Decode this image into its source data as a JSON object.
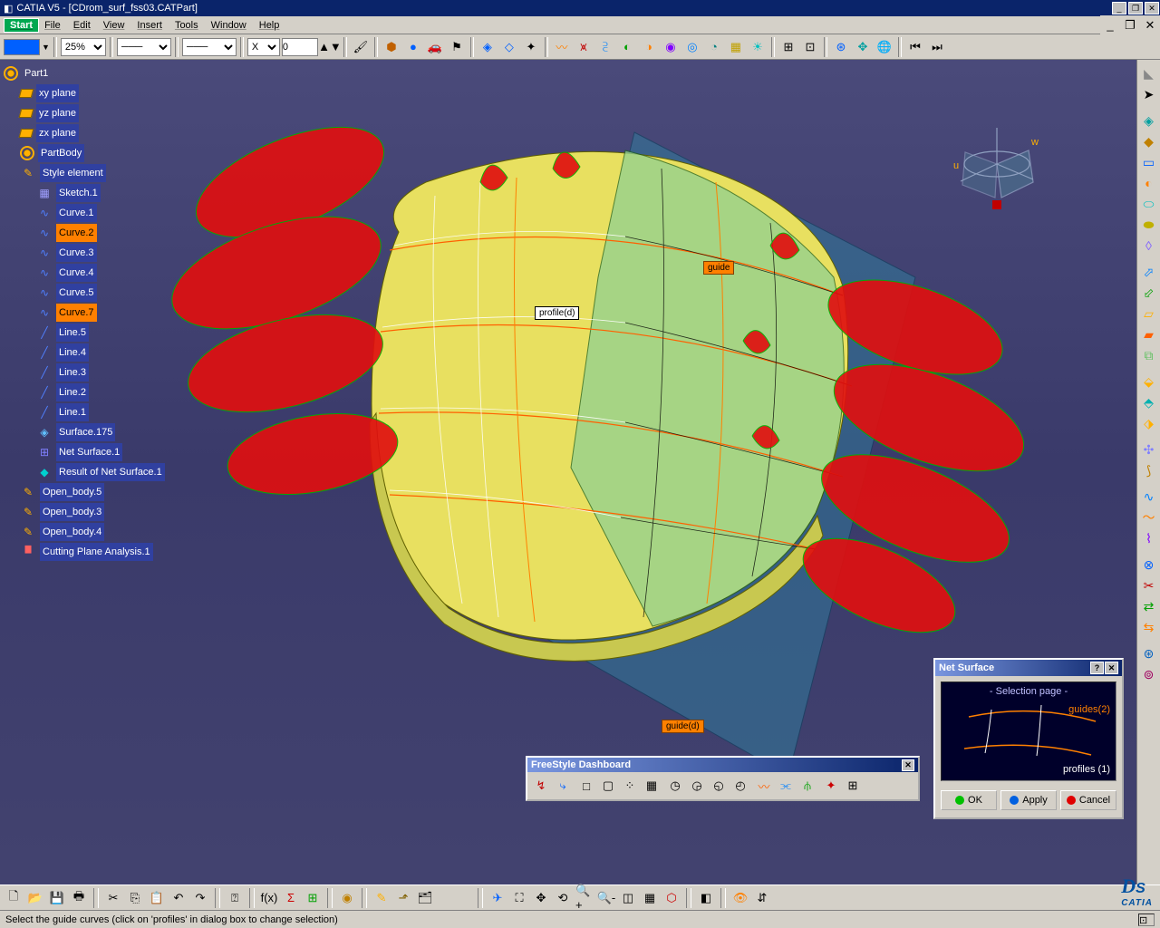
{
  "title": "CATIA V5 - [CDrom_surf_fss03.CATPart]",
  "menu": {
    "start": "Start",
    "file": "File",
    "edit": "Edit",
    "view": "View",
    "insert": "Insert",
    "tools": "Tools",
    "window": "Window",
    "help": "Help"
  },
  "toolbar": {
    "zoom": "25%",
    "coord_axis": "X",
    "coord_val": "0"
  },
  "tree": {
    "root": "Part1",
    "planes": [
      "xy plane",
      "yz plane",
      "zx plane"
    ],
    "partbody": "PartBody",
    "style": "Style element",
    "sketch": "Sketch.1",
    "curves": [
      "Curve.1",
      "Curve.2",
      "Curve.3",
      "Curve.4",
      "Curve.5",
      "Curve.7"
    ],
    "curves_hot": [
      1,
      5
    ],
    "lines": [
      "Line.5",
      "Line.4",
      "Line.3",
      "Line.2",
      "Line.1"
    ],
    "surface": "Surface.175",
    "netsurf": "Net Surface.1",
    "result": "Result of Net Surface.1",
    "bodies": [
      "Open_body.5",
      "Open_body.3",
      "Open_body.4"
    ],
    "analysis": "Cutting Plane Analysis.1"
  },
  "viewport": {
    "profile_label": "profile(d)",
    "guide_text": "guide",
    "guide_d_label": "guide(d)",
    "compass_u": "u",
    "compass_w": "w"
  },
  "fsdash": {
    "title": "FreeStyle Dashboard"
  },
  "netdlg": {
    "title": "Net Surface",
    "selection": "- Selection page -",
    "guides": "guides(2)",
    "profiles": "profiles (1)",
    "ok": "OK",
    "apply": "Apply",
    "cancel": "Cancel"
  },
  "status": "Select the guide curves (click on 'profiles' in dialog box to change selection)",
  "logo": "CATIA"
}
